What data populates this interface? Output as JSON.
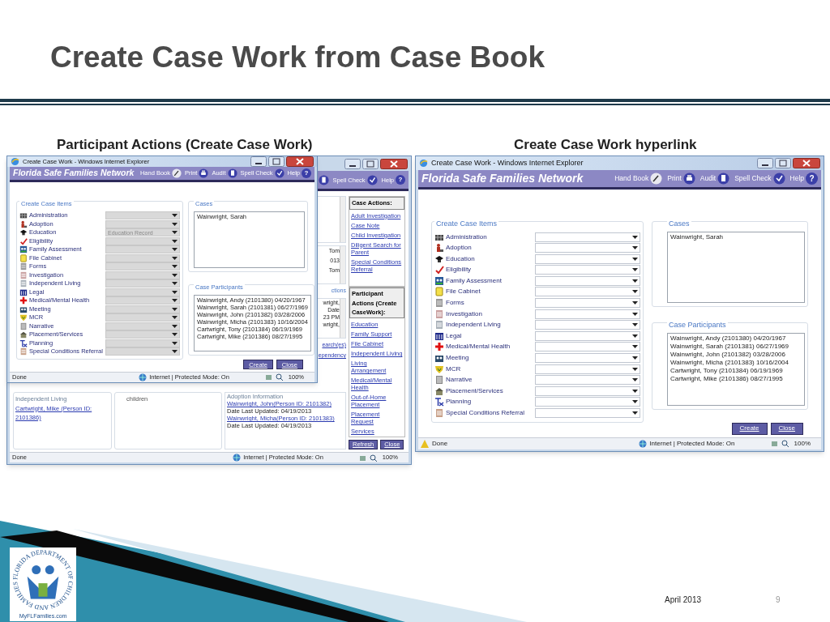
{
  "slide": {
    "title": "Create Case Work from Case Book",
    "captions": [
      "Participant Actions (Create Case Work)",
      "Create Case Work hyperlink"
    ],
    "logo_ring_text": "FLORIDA DEPARTMENT OF CHILDREN AND FAMILIES",
    "logo_caption": "MyFLFamilies.com",
    "date": "April 2013",
    "page_number": "9"
  },
  "left_screenshot": {
    "background_window": {
      "toolbar": [
        {
          "label": "Spell Check"
        },
        {
          "label": "Help",
          "glyph": "?"
        }
      ],
      "fragments_b": [
        "Tom",
        "013",
        "Tom"
      ],
      "fragments_c_heading": "ctions",
      "fragments_c": [
        "wright,",
        "Date",
        "23 PM",
        "wright,"
      ],
      "fragment_links": [
        "earch(es)",
        "ependency"
      ],
      "independent_living": {
        "heading": "Independent Living",
        "links": [
          "Cartwright, Mike (Person ID: 2101386)"
        ]
      },
      "children_card": {
        "text": "children"
      },
      "adoption": {
        "heading": "Adoption Information",
        "entries": [
          {
            "link": "Wainwright, John(Person ID: 2101382)",
            "updated": "Date Last Updated: 04/19/2013"
          },
          {
            "link": "Wainwright, Micha(Person ID: 2101383)",
            "updated": "Date Last Updated: 04/19/2013"
          }
        ]
      },
      "case_actions": {
        "heading": "Case Actions:",
        "links": [
          "Adult Investigation",
          "Case Note",
          "Child Investigation",
          "Diligent Search for Parent",
          "Special Conditions Referral"
        ]
      },
      "participant_actions": {
        "heading": "Participant Actions (Create CaseWork):",
        "links": [
          "Education",
          "Family Support",
          "File Cabinet",
          "Independent Living",
          "Living Arrangement",
          "Medical/Mental Health",
          "Out-of-Home Placement",
          "Placement Request",
          "Services"
        ]
      },
      "buttons": [
        "Refresh",
        "Close"
      ],
      "status_bar": {
        "text": "Done",
        "zone": "Internet | Protected Mode: On",
        "zoom": "100%"
      }
    },
    "popup": {
      "title": "Create Case Work - Windows Internet Explorer",
      "app_name": "Florida Safe Families Network",
      "toolbar": [
        {
          "label": "Hand Book"
        },
        {
          "label": "Print"
        },
        {
          "label": "Audit"
        },
        {
          "label": "Spell Check"
        },
        {
          "label": "Help",
          "glyph": "?"
        }
      ],
      "items_legend": "Create Case Items",
      "disabled": true,
      "items": [
        {
          "label": "Administration"
        },
        {
          "label": "Adoption"
        },
        {
          "label": "Education",
          "value": "Education Record"
        },
        {
          "label": "Eligibility"
        },
        {
          "label": "Family Assessment"
        },
        {
          "label": "File Cabinet"
        },
        {
          "label": "Forms"
        },
        {
          "label": "Investigation"
        },
        {
          "label": "Independent Living"
        },
        {
          "label": "Legal"
        },
        {
          "label": "Medical/Mental Health"
        },
        {
          "label": "Meeting"
        },
        {
          "label": "MCR"
        },
        {
          "label": "Narrative"
        },
        {
          "label": "Placement/Services"
        },
        {
          "label": "Planning"
        },
        {
          "label": "Special Conditions Referral"
        }
      ],
      "cases_legend": "Cases",
      "cases": [
        "Wainwright, Sarah"
      ],
      "participants_legend": "Case Participants",
      "participants": [
        "Wainwright, Andy (2101380) 04/20/1967",
        "Wainwright, Sarah (2101381) 06/27/1969",
        "Wainwright, John (2101382) 03/28/2006",
        "Wainwright, Micha (2101383) 10/16/2004",
        "Cartwright, Tony (2101384) 06/19/1969",
        "Cartwright, Mike (2101386) 08/27/1995"
      ],
      "buttons": [
        "Create",
        "Close"
      ],
      "status_bar": {
        "text": "Done",
        "zone": "Internet | Protected Mode: On",
        "zoom": "100%",
        "warning": false
      }
    }
  },
  "right_screenshot": {
    "window": {
      "title": "Create Case Work - Windows Internet Explorer",
      "app_name": "Florida Safe Families Network",
      "toolbar": [
        {
          "label": "Hand Book"
        },
        {
          "label": "Print"
        },
        {
          "label": "Audit"
        },
        {
          "label": "Spell Check"
        },
        {
          "label": "Help",
          "glyph": "?"
        }
      ],
      "items_legend": "Create Case Items",
      "disabled": false,
      "items": [
        {
          "label": "Administration"
        },
        {
          "label": "Adoption"
        },
        {
          "label": "Education"
        },
        {
          "label": "Eligibility"
        },
        {
          "label": "Family Assessment"
        },
        {
          "label": "File Cabinet"
        },
        {
          "label": "Forms"
        },
        {
          "label": "Investigation"
        },
        {
          "label": "Independent Living"
        },
        {
          "label": "Legal"
        },
        {
          "label": "Medical/Mental Health"
        },
        {
          "label": "Meeting"
        },
        {
          "label": "MCR"
        },
        {
          "label": "Narrative"
        },
        {
          "label": "Placement/Services"
        },
        {
          "label": "Planning"
        },
        {
          "label": "Special Conditions Referral"
        }
      ],
      "cases_legend": "Cases",
      "cases": [
        "Wainwright, Sarah"
      ],
      "participants_legend": "Case Participants",
      "participants": [
        "Wainwright, Andy (2101380) 04/20/1967",
        "Wainwright, Sarah (2101381) 06/27/1969",
        "Wainwright, John (2101382) 03/28/2006",
        "Wainwright, Micha (2101383) 10/16/2004",
        "Cartwright, Tony (2101384) 06/19/1969",
        "Cartwright, Mike (2101386) 08/27/1995"
      ],
      "buttons": [
        "Create",
        "Close"
      ],
      "status_bar": {
        "text": "Done",
        "zone": "Internet | Protected Mode: On",
        "zoom": "100%",
        "warning": true
      }
    }
  }
}
